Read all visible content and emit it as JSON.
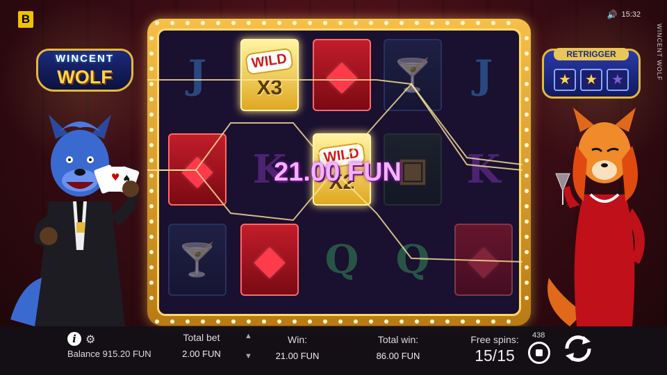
{
  "header": {
    "brand_letter": "B",
    "time": "15:32",
    "game_name_vertical": "WINCENT WOLF"
  },
  "logo": {
    "line1": "WINCENT",
    "line2": "WOLF"
  },
  "retrigger": {
    "label": "RETRIGGER",
    "stars": [
      "★",
      "★",
      "★"
    ]
  },
  "reels": {
    "cells": [
      {
        "symbol": "J",
        "type": "letter",
        "color": "#3a8fe0",
        "dim": true
      },
      {
        "symbol": "WILD",
        "type": "wild",
        "multiplier": "X3",
        "dim": false
      },
      {
        "symbol": "gem",
        "type": "gem",
        "dim": false
      },
      {
        "symbol": "martini",
        "type": "glass",
        "dim": true
      },
      {
        "symbol": "J",
        "type": "letter",
        "color": "#3a8fe0",
        "dim": true
      },
      {
        "symbol": "gem",
        "type": "gem",
        "dim": false
      },
      {
        "symbol": "K",
        "type": "letter",
        "color": "#8a3ac0",
        "dim": true
      },
      {
        "symbol": "WILD",
        "type": "wild",
        "multiplier": "X2",
        "dim": false
      },
      {
        "symbol": "chest",
        "type": "green",
        "dim": true
      },
      {
        "symbol": "K",
        "type": "letter",
        "color": "#8a3ac0",
        "dim": true
      },
      {
        "symbol": "martini",
        "type": "glass",
        "dim": true
      },
      {
        "symbol": "gem",
        "type": "gem",
        "dim": false
      },
      {
        "symbol": "Q",
        "type": "letter",
        "color": "#3aa860",
        "dim": true
      },
      {
        "symbol": "Q",
        "type": "letter",
        "color": "#3aa860",
        "dim": true
      },
      {
        "symbol": "gem",
        "type": "gem",
        "dim": true
      }
    ]
  },
  "win_banner": "21.00 FUN",
  "bottom": {
    "balance_label": "Balance",
    "balance_value": "915.20 FUN",
    "total_bet_label": "Total bet",
    "total_bet_value": "2.00 FUN",
    "win_label": "Win:",
    "win_value": "21.00 FUN",
    "total_win_label": "Total win:",
    "total_win_value": "86.00 FUN",
    "free_spins_label": "Free spins:",
    "free_spins_value": "15/15",
    "autoplay_count": "438"
  },
  "icons": {
    "info": "i",
    "gear": "⚙",
    "speaker": "🔊",
    "up": "▲",
    "down": "▼"
  }
}
